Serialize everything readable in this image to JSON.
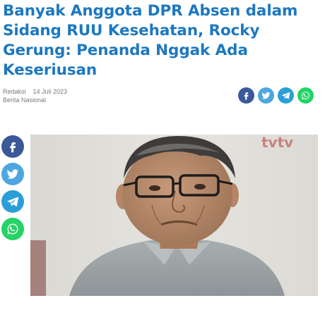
{
  "article": {
    "title": "Banyak Anggota DPR Absen dalam Sidang RUU Kesehatan, Rocky Gerung: Penanda Nggak Ada Keseriusan",
    "author": "Redaksi",
    "date": "14 Juli 2023",
    "source": "Berita Nasional"
  },
  "share": {
    "buttons": [
      {
        "icon": "facebook-icon",
        "color": "#3b5998"
      },
      {
        "icon": "twitter-icon",
        "color": "#4da7de"
      },
      {
        "icon": "telegram-icon",
        "color": "#2a9ed6"
      },
      {
        "icon": "whatsapp-icon",
        "color": "#25d366"
      }
    ]
  },
  "image": {
    "watermark": "tvtv"
  }
}
